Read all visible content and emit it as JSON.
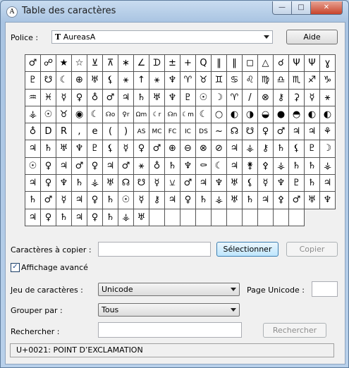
{
  "window": {
    "title": "Table des caractères",
    "min_glyph": "—",
    "max_glyph": "□",
    "close_glyph": "✕"
  },
  "font": {
    "label": "Police :",
    "value": "AureasA",
    "icon_glyph": "T"
  },
  "help_button": "Aide",
  "grid": [
    "♂",
    "☍",
    "★",
    "☆",
    "⊻",
    "⊼",
    "∗",
    "∠",
    "ᗪ",
    "±",
    "+",
    "Q",
    "‖",
    "‖",
    "◻",
    "△",
    "☌",
    "Ψ",
    "Ψ",
    "ɣ",
    "♇",
    "☋",
    "☾",
    "⊕",
    "♅",
    "⚸",
    "⚹",
    "↑",
    "⚹",
    "♆",
    "♈",
    "♉",
    "♊",
    "♋",
    "♌",
    "♍",
    "♎",
    "♏",
    "♐",
    "♑",
    "♒",
    "♓",
    "☿",
    "♀",
    "♁",
    "♂",
    "♃",
    "♄",
    "♅",
    "♆",
    "♇",
    "☉",
    "☽",
    "♈",
    "/",
    "⊗",
    "⚷",
    "⚳",
    "☿",
    "⚹",
    "⚶",
    "☉",
    "♉",
    "◉",
    "☾",
    "☊o",
    "♀r",
    "Ωm",
    "☾r",
    "☊n",
    "☾m",
    "☾",
    "○",
    "◐",
    "◑",
    "◒",
    "●",
    "◓",
    "◐",
    "◐",
    "♁",
    "D",
    "R",
    ",",
    "e",
    "(",
    ")",
    "AS",
    "MC",
    "FC",
    "IC",
    "DS",
    "~",
    "☊",
    "☋",
    "♀",
    "♂",
    "♃",
    "♃",
    "⚘",
    "♃",
    "♄",
    "♅",
    "♆",
    "♇",
    "⚸",
    "☿",
    "♀",
    "♂",
    "⊕",
    "⊖",
    "⊗",
    "⊘",
    "♃",
    "⚶",
    "⚷",
    "♄",
    "⚸",
    "♇",
    "☽",
    "☉",
    "♀",
    "♃",
    "♂",
    "♀",
    "♃",
    "♂",
    "⚹",
    "♁",
    "♄",
    "♆",
    "⚰",
    "☾",
    "♃",
    "⚵",
    "⚴",
    "⚶",
    "♄",
    "♄",
    "⚶",
    "♃",
    "♀",
    "♆",
    "♄",
    "⚶",
    "♅",
    "☊",
    "☋",
    "☿",
    "⚺",
    "♂",
    "♃",
    "♆",
    "♅",
    "⚸",
    "☿",
    "♆",
    "♇",
    "♄",
    "♃",
    "♄",
    "♂",
    "☿",
    "♃",
    "♀",
    "♄",
    "☉",
    "☿",
    "⚷",
    "♃",
    "♀",
    "♄",
    "⚶",
    "♅",
    "♄",
    "♃",
    "⚴",
    "♂",
    "♅",
    "♆",
    "♃",
    "♀",
    "♄",
    "♃",
    "♀",
    "♄",
    "⚶",
    "♅",
    "",
    "",
    "",
    "",
    "",
    "",
    "",
    "",
    "",
    ""
  ],
  "copy": {
    "label": "Caractères à copier :",
    "value": "",
    "select_button": "Sélectionner",
    "copy_button": "Copier"
  },
  "advanced": {
    "label": "Affichage avancé",
    "checked_glyph": "✓"
  },
  "charset": {
    "label": "Jeu de caractères :",
    "value": "Unicode",
    "page_label": "Page Unicode :",
    "page_value": ""
  },
  "group": {
    "label": "Grouper par :",
    "value": "Tous"
  },
  "search": {
    "label": "Rechercher :",
    "value": "",
    "button": "Rechercher"
  },
  "status": "U+0021: POINT D’EXCLAMATION"
}
